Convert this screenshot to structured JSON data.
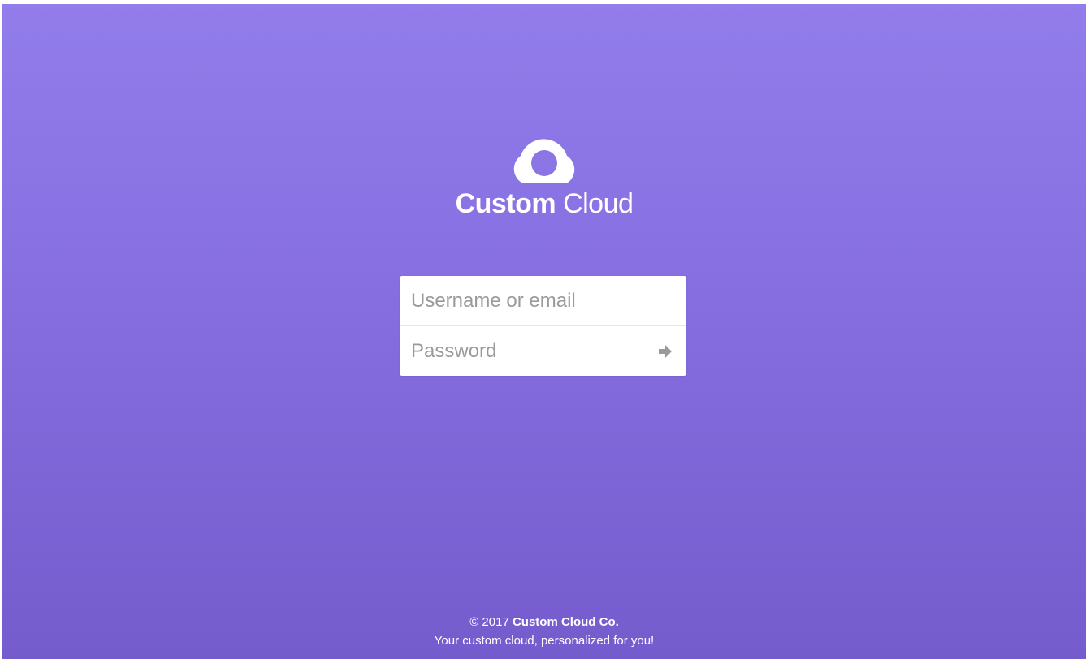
{
  "brand": {
    "name_bold": "Custom",
    "name_light": "Cloud",
    "logo_icon": "cloud-icon"
  },
  "login": {
    "username_placeholder": "Username or email",
    "password_placeholder": "Password",
    "submit_icon": "arrow-right-icon"
  },
  "footer": {
    "copyright": "© 2017",
    "company": "Custom Cloud Co.",
    "tagline": "Your custom cloud, personalized for you!"
  },
  "colors": {
    "background_top": "#927deb",
    "background_bottom": "#755ccd",
    "text": "#ffffff",
    "placeholder": "#9a9a9a",
    "icon": "#9a9a9a"
  }
}
